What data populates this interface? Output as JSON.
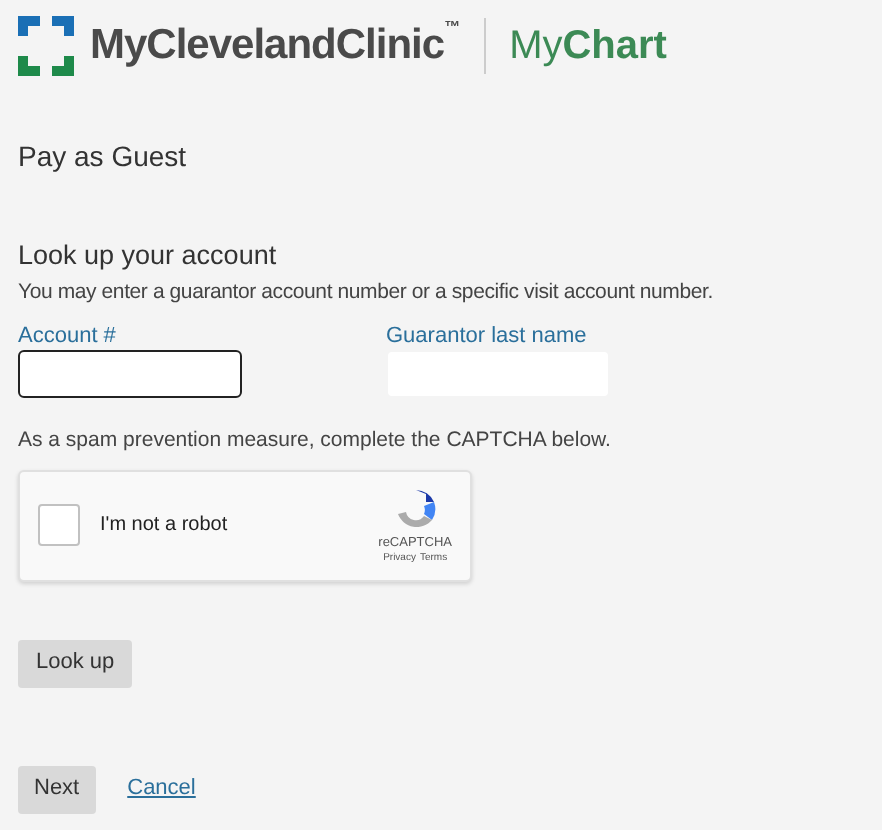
{
  "header": {
    "brand": "MyClevelandClinic",
    "trademark": "™",
    "product_prefix": "My",
    "product": "Chart"
  },
  "page_title": "Pay as Guest",
  "section": {
    "title": "Look up your account",
    "hint": "You may enter a guarantor account number or a specific visit account number."
  },
  "fields": [
    {
      "label": "Account #",
      "focused": true
    },
    {
      "label": "Guarantor last name",
      "focused": false
    }
  ],
  "captcha_note": "As a spam prevention measure, complete the CAPTCHA below.",
  "captcha": {
    "label": "I'm not a robot",
    "checked": false,
    "brand": "reCAPTCHA",
    "links": [
      "Privacy",
      "Terms"
    ]
  },
  "lookup_button": "Look up",
  "footer": {
    "next": "Next",
    "cancel": "Cancel"
  }
}
